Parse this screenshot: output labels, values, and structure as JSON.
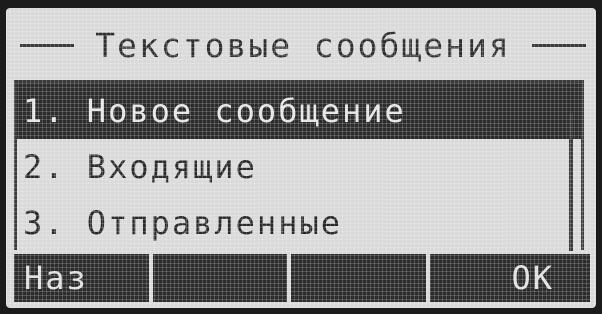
{
  "screen": {
    "title": "Текстовые сообщения"
  },
  "menu": {
    "items": [
      {
        "label": "1. Новое сообщение",
        "selected": true
      },
      {
        "label": "2. Входящие",
        "selected": false
      },
      {
        "label": "3. Отправленные",
        "selected": false
      }
    ]
  },
  "softkeys": {
    "left": "Наз",
    "mid1": "",
    "mid2": "",
    "right": "OK"
  },
  "colors": {
    "lcd_background": "#d9d9d9",
    "lcd_ink": "#2c2c2c"
  }
}
